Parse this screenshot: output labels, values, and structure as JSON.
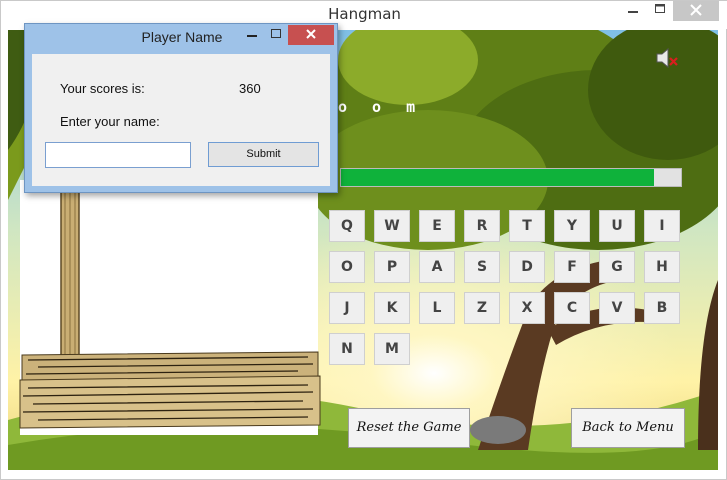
{
  "window": {
    "title": "Hangman",
    "minimize_icon": "minimize-icon",
    "maximize_icon": "maximize-icon",
    "close_icon": "close-icon"
  },
  "game": {
    "word_display": "o o m",
    "progress_fraction": 0.92,
    "sound_icon": "muted-speaker-icon",
    "letters": [
      "Q",
      "W",
      "E",
      "R",
      "T",
      "Y",
      "U",
      "I",
      "O",
      "P",
      "A",
      "S",
      "D",
      "F",
      "G",
      "H",
      "J",
      "K",
      "L",
      "Z",
      "X",
      "C",
      "V",
      "B",
      "N",
      "M"
    ],
    "reset_label": "Reset the Game",
    "menu_label": "Back to Menu"
  },
  "dialog": {
    "title": "Player Name",
    "score_label": "Your scores is:",
    "score_value": "360",
    "name_label": "Enter your name:",
    "name_value": "",
    "submit_label": "Submit"
  },
  "colors": {
    "progress_green": "#0fb23b",
    "dialog_frame": "#9ec2e8",
    "dialog_close": "#c75050"
  }
}
